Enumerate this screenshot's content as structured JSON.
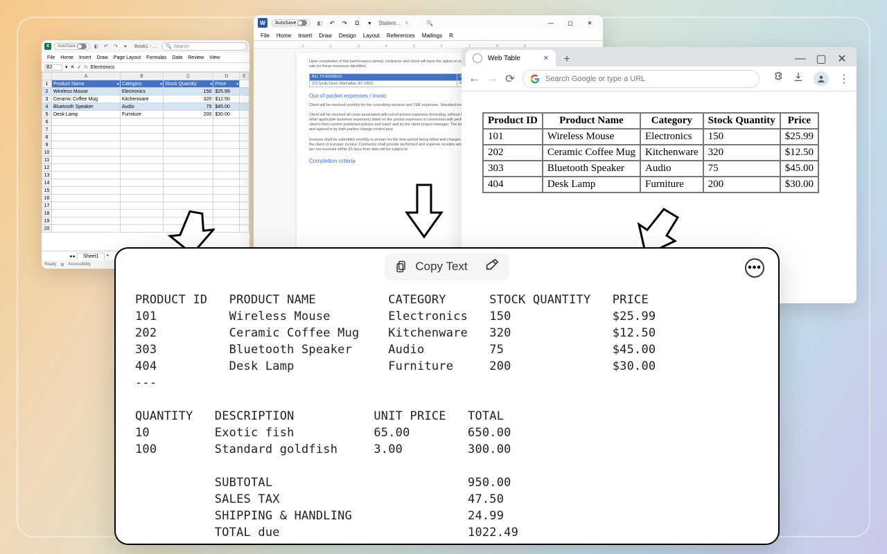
{
  "excel": {
    "autosave": "AutoSave",
    "docname": "Book1 - ...",
    "search_placeholder": "Search",
    "ribbon": [
      "File",
      "Home",
      "Insert",
      "Draw",
      "Page Layout",
      "Formulas",
      "Data",
      "Review",
      "View"
    ],
    "cellref": "B2",
    "formula": "Electronics",
    "colheads": [
      "A",
      "B",
      "C",
      "D",
      "E"
    ],
    "headers": [
      "Product Name",
      "Category",
      "Stock Quantity",
      "Price"
    ],
    "rows": [
      [
        "Wireless Mouse",
        "Electronics",
        "150",
        "$25.99"
      ],
      [
        "Ceramic Coffee Mug",
        "Kitchenware",
        "320",
        "$12.50"
      ],
      [
        "Bluetooth Speaker",
        "Audio",
        "75",
        "$45.00"
      ],
      [
        "Desk Lamp",
        "Furniture",
        "200",
        "$30.00"
      ]
    ],
    "sheet": "Sheet1",
    "status_ready": "Ready",
    "status_access": "Accessibility"
  },
  "word": {
    "autosave": "AutoSave",
    "docname": "Statem...",
    "ribbon": [
      "File",
      "Home",
      "Insert",
      "Draw",
      "Design",
      "Layout",
      "References",
      "Mailings",
      "R"
    ],
    "body_intro": "Upon completion of this performance period, contractor and client will have the option to renew the number of hours at the then-current hourly rate for these resources identified.",
    "bill_hdr_l": "BILL TO ADDRESS",
    "bill_hdr_r": "CLIENT PROJECT",
    "bill_l": "123 South Street, Manhattan, NY 10021",
    "bill_r": "Project Manager Name",
    "h1": "Out-of-pocket expenses / invoic",
    "p1": "Client will be invoiced monthly for the consulting services and T&E expenses. Standard invoices are due upon receipt.",
    "p2": "Client will be invoiced all costs associated with out-of-pocket expenses (including, without limitation, lodging, local transportation and any other applicable business expenses) listed on the pocket expenses in connection with performance of this authorized and in accordance with client's then-current published policies and travel and by the client project manager. The limit of reimbursement to the 50 authorized in writing and agreed to by both parties change control proc",
    "p3": "Invoices shall be submitted monthly in arrears for the time period being billed and charges for the time period being billed and costs details to the client of a proper invoice. Contractor shall provide performed and expense receipts and justifications for invoices, sales or invoiced that are not received within 30 days from date will be subject to",
    "h2": "Completion criteria"
  },
  "browser": {
    "tab_title": "Web Table",
    "omnibox_placeholder": "Search Google or type a URL",
    "headers": [
      "Product ID",
      "Product Name",
      "Category",
      "Stock Quantity",
      "Price"
    ],
    "rows": [
      [
        "101",
        "Wireless Mouse",
        "Electronics",
        "150",
        "$25.99"
      ],
      [
        "202",
        "Ceramic Coffee Mug",
        "Kitchenware",
        "320",
        "$12.50"
      ],
      [
        "303",
        "Bluetooth Speaker",
        "Audio",
        "75",
        "$45.00"
      ],
      [
        "404",
        "Desk Lamp",
        "Furniture",
        "200",
        "$30.00"
      ]
    ]
  },
  "card": {
    "copy_label": "Copy Text",
    "text": "PRODUCT ID   PRODUCT NAME          CATEGORY      STOCK QUANTITY   PRICE\n101          Wireless Mouse        Electronics   150              $25.99\n202          Ceramic Coffee Mug    Kitchenware   320              $12.50\n303          Bluetooth Speaker     Audio         75               $45.00\n404          Desk Lamp             Furniture     200              $30.00\n---\n\nQUANTITY   DESCRIPTION           UNIT PRICE   TOTAL\n10         Exotic fish           65.00        650.00\n100        Standard goldfish     3.00         300.00\n\n           SUBTOTAL                           950.00\n           SALES TAX                          47.50\n           SHIPPING & HANDLING                24.99\n           TOTAL due                          1022.49"
  }
}
